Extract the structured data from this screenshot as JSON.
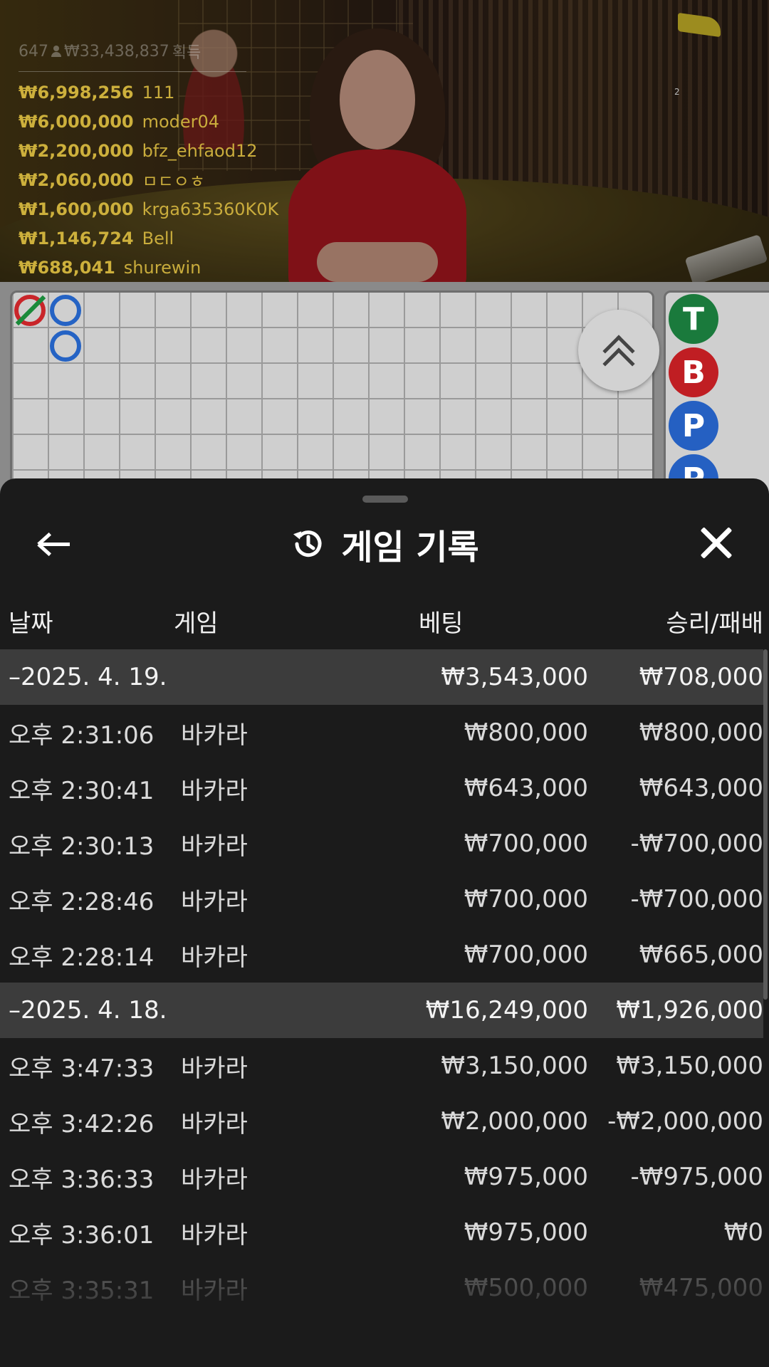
{
  "video": {
    "counter": "2",
    "winners_header": {
      "players": "647",
      "total": "₩33,438,837",
      "label": "획득"
    },
    "winners": [
      {
        "amount": "₩6,998,256",
        "name": "111"
      },
      {
        "amount": "₩6,000,000",
        "name": "moder04"
      },
      {
        "amount": "₩2,200,000",
        "name": "bfz_ehfaod12"
      },
      {
        "amount": "₩2,060,000",
        "name": "ㅁㄷㅇㅎ"
      },
      {
        "amount": "₩1,600,000",
        "name": "krga635360K0K"
      },
      {
        "amount": "₩1,146,724",
        "name": "Bell"
      },
      {
        "amount": "₩688,041",
        "name": "shurewin"
      }
    ]
  },
  "roadmap": {
    "side_pills": [
      "T",
      "B",
      "P",
      "P"
    ]
  },
  "history": {
    "title": "게임 기록",
    "columns": {
      "date": "날짜",
      "game": "게임",
      "bet": "베팅",
      "result": "승리/패배"
    },
    "groups": [
      {
        "date": "–2025. 4. 19.",
        "bet": "₩3,543,000",
        "result": "₩708,000",
        "rows": [
          {
            "time": "오후 2:31:06",
            "game": "바카라",
            "bet": "₩800,000",
            "result": "₩800,000"
          },
          {
            "time": "오후 2:30:41",
            "game": "바카라",
            "bet": "₩643,000",
            "result": "₩643,000"
          },
          {
            "time": "오후 2:30:13",
            "game": "바카라",
            "bet": "₩700,000",
            "result": "-₩700,000"
          },
          {
            "time": "오후 2:28:46",
            "game": "바카라",
            "bet": "₩700,000",
            "result": "-₩700,000"
          },
          {
            "time": "오후 2:28:14",
            "game": "바카라",
            "bet": "₩700,000",
            "result": "₩665,000"
          }
        ]
      },
      {
        "date": "–2025. 4. 18.",
        "bet": "₩16,249,000",
        "result": "₩1,926,000",
        "rows": [
          {
            "time": "오후 3:47:33",
            "game": "바카라",
            "bet": "₩3,150,000",
            "result": "₩3,150,000"
          },
          {
            "time": "오후 3:42:26",
            "game": "바카라",
            "bet": "₩2,000,000",
            "result": "-₩2,000,000"
          },
          {
            "time": "오후 3:36:33",
            "game": "바카라",
            "bet": "₩975,000",
            "result": "-₩975,000"
          },
          {
            "time": "오후 3:36:01",
            "game": "바카라",
            "bet": "₩975,000",
            "result": "₩0"
          },
          {
            "time": "오후 3:35:31",
            "game": "바카라",
            "bet": "₩500,000",
            "result": "₩475,000"
          }
        ]
      }
    ]
  },
  "colors": {
    "sheet_bg": "#1b1b1b",
    "group_bg": "#3c3c3c",
    "winner_text": "#cdb03c",
    "player_blue": "#2560c2",
    "banker_red": "#c01e23",
    "tie_green": "#1a7a3c"
  },
  "icons": {
    "back": "arrow-left-icon",
    "history": "history-clock-icon",
    "close": "close-icon",
    "collapse": "double-chevron-up-icon"
  }
}
